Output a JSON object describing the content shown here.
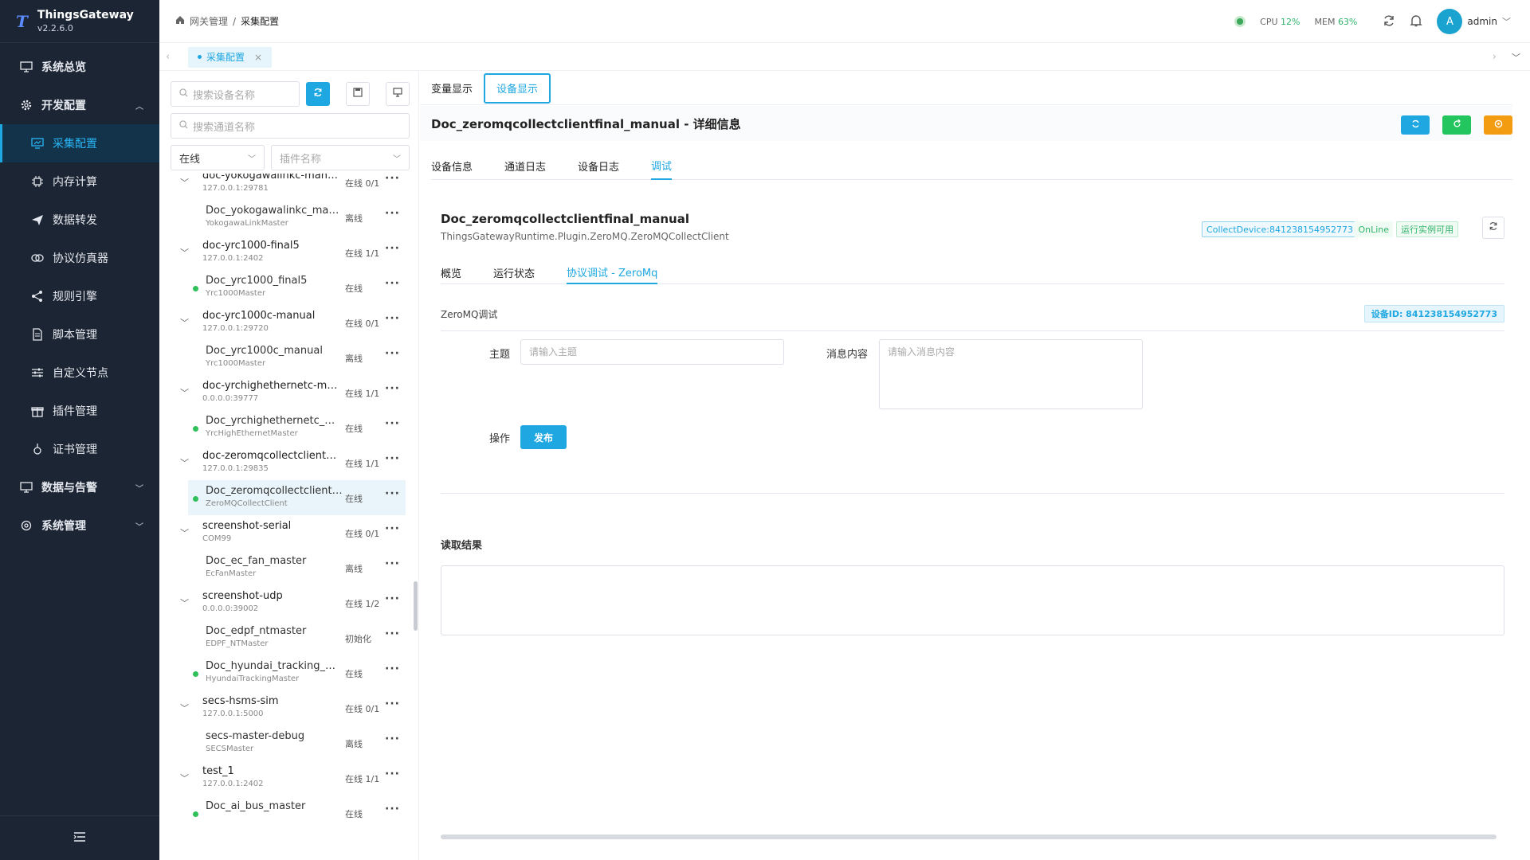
{
  "brand": {
    "name": "ThingsGateway",
    "version": "v2.2.6.0",
    "logo": "T"
  },
  "nav": {
    "overview": "系统总览",
    "dev_group": "开发配置",
    "collect": "采集配置",
    "memory": "内存计算",
    "forward": "数据转发",
    "simulator": "协议仿真器",
    "rules": "规则引擎",
    "scripts": "脚本管理",
    "custom_nodes": "自定义节点",
    "plugins": "插件管理",
    "certs": "证书管理",
    "data_alarm": "数据与告警",
    "system": "系统管理"
  },
  "header": {
    "breadcrumb_root": "网关管理",
    "breadcrumb_sep": "/",
    "breadcrumb_current": "采集配置",
    "cpu_label": "CPU",
    "cpu_value": "12%",
    "mem_label": "MEM",
    "mem_value": "63%",
    "avatar_letter": "A",
    "user": "admin"
  },
  "tabs": {
    "open_tab": "采集配置"
  },
  "left": {
    "search_device_placeholder": "搜索设备名称",
    "search_channel_placeholder": "搜索通道名称",
    "status_select": "在线",
    "plugin_select_placeholder": "插件名称"
  },
  "tree": [
    {
      "type": "channel",
      "name": "doc-yokogawalinkc-manual",
      "sub": "127.0.0.1:29781",
      "status": "在线 0/1"
    },
    {
      "type": "device",
      "name": "Doc_yokogawalinkc_manual",
      "sub": "YokogawaLinkMaster",
      "status": "离线",
      "online": false
    },
    {
      "type": "channel",
      "name": "doc-yrc1000-final5",
      "sub": "127.0.0.1:2402",
      "status": "在线 1/1"
    },
    {
      "type": "device",
      "name": "Doc_yrc1000_final5",
      "sub": "Yrc1000Master",
      "status": "在线",
      "online": true
    },
    {
      "type": "channel",
      "name": "doc-yrc1000c-manual",
      "sub": "127.0.0.1:29720",
      "status": "在线 0/1"
    },
    {
      "type": "device",
      "name": "Doc_yrc1000c_manual",
      "sub": "Yrc1000Master",
      "status": "离线",
      "online": false
    },
    {
      "type": "channel",
      "name": "doc-yrchighethernetc-man...",
      "sub": "0.0.0.0:39777",
      "status": "在线 1/1"
    },
    {
      "type": "device",
      "name": "Doc_yrchighethernetc_manual",
      "sub": "YrcHighEthernetMaster",
      "status": "在线",
      "online": true
    },
    {
      "type": "channel",
      "name": "doc-zeromqcollectclientfin...",
      "sub": "127.0.0.1:29835",
      "status": "在线 1/1"
    },
    {
      "type": "device",
      "name": "Doc_zeromqcollectclientfinal...",
      "sub": "ZeroMQCollectClient",
      "status": "在线",
      "online": true,
      "selected": true
    },
    {
      "type": "channel",
      "name": "screenshot-serial",
      "sub": "COM99",
      "status": "在线 0/1"
    },
    {
      "type": "device",
      "name": "Doc_ec_fan_master",
      "sub": "EcFanMaster",
      "status": "离线",
      "online": false
    },
    {
      "type": "channel",
      "name": "screenshot-udp",
      "sub": "0.0.0.0:39002",
      "status": "在线 1/2"
    },
    {
      "type": "device",
      "name": "Doc_edpf_ntmaster",
      "sub": "EDPF_NTMaster",
      "status": "初始化",
      "online": false
    },
    {
      "type": "device",
      "name": "Doc_hyundai_tracking_master",
      "sub": "HyundaiTrackingMaster",
      "status": "在线",
      "online": true
    },
    {
      "type": "channel",
      "name": "secs-hsms-sim",
      "sub": "127.0.0.1:5000",
      "status": "在线 0/1"
    },
    {
      "type": "device",
      "name": "secs-master-debug",
      "sub": "SECSMaster",
      "status": "离线",
      "online": false
    },
    {
      "type": "channel",
      "name": "test_1",
      "sub": "127.0.0.1:2402",
      "status": "在线 1/1"
    },
    {
      "type": "device",
      "name": "Doc_ai_bus_master",
      "sub": "",
      "status": "在线",
      "online": true
    }
  ],
  "main": {
    "view_tabs": [
      "变量显示",
      "设备显示"
    ],
    "detail_title": "Doc_zeromqcollectclientfinal_manual - 详细信息",
    "inner_tabs": [
      "设备信息",
      "通道日志",
      "设备日志",
      "调试"
    ],
    "device_name": "Doc_zeromqcollectclientfinal_manual",
    "plugin": "ThingsGatewayRuntime.Plugin.ZeroMQ.ZeroMQCollectClient",
    "badge_collect": "CollectDevice:841238154952773",
    "badge_online": "OnLine",
    "badge_runtime": "运行实例可用",
    "sub_tabs": [
      "概览",
      "运行状态",
      "协议调试 - ZeroMq"
    ],
    "section_label": "ZeroMQ调试",
    "device_id": "设备ID: 841238154952773",
    "topic_label": "主题",
    "topic_placeholder": "请输入主题",
    "message_label": "消息内容",
    "message_placeholder": "请输入消息内容",
    "action_label": "操作",
    "publish": "发布",
    "result_label": "读取结果"
  },
  "colors": {
    "accent": "#1ea7e0",
    "sidebar": "#1c2533",
    "online": "#2fc05a",
    "warn": "#f39c12"
  }
}
